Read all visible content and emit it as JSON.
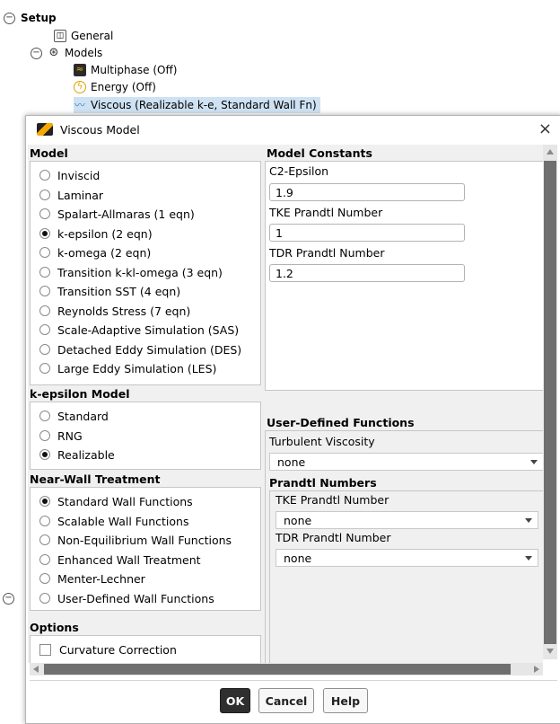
{
  "tree": {
    "setup": "Setup",
    "general": "General",
    "models": "Models",
    "multiphase": "Multiphase (Off)",
    "energy": "Energy (Off)",
    "viscous": "Viscous (Realizable k-e, Standard Wall Fn)"
  },
  "dialog": {
    "title": "Viscous Model",
    "close": "×",
    "model": {
      "label": "Model",
      "options": [
        "Inviscid",
        "Laminar",
        "Spalart-Allmaras (1 eqn)",
        "k-epsilon (2 eqn)",
        "k-omega (2 eqn)",
        "Transition k-kl-omega (3 eqn)",
        "Transition SST (4 eqn)",
        "Reynolds Stress (7 eqn)",
        "Scale-Adaptive Simulation (SAS)",
        "Detached Eddy Simulation (DES)",
        "Large Eddy Simulation (LES)"
      ],
      "selected": "k-epsilon (2 eqn)"
    },
    "kepsilon": {
      "label": "k-epsilon Model",
      "options": [
        "Standard",
        "RNG",
        "Realizable"
      ],
      "selected": "Realizable"
    },
    "nearwall": {
      "label": "Near-Wall Treatment",
      "options": [
        "Standard Wall Functions",
        "Scalable Wall Functions",
        "Non-Equilibrium Wall Functions",
        "Enhanced Wall Treatment",
        "Menter-Lechner",
        "User-Defined Wall Functions"
      ],
      "selected": "Standard Wall Functions"
    },
    "options": {
      "label": "Options",
      "curvature": "Curvature Correction"
    },
    "constants": {
      "label": "Model Constants",
      "c2eps_label": "C2-Epsilon",
      "c2eps_value": "1.9",
      "tke_label": "TKE Prandtl Number",
      "tke_value": "1",
      "tdr_label": "TDR Prandtl Number",
      "tdr_value": "1.2"
    },
    "udf": {
      "label": "User-Defined Functions",
      "turb_visc_label": "Turbulent Viscosity",
      "turb_visc_value": "none",
      "prandtl_label": "Prandtl Numbers",
      "tke_label": "TKE Prandtl Number",
      "tke_value": "none",
      "tdr_label": "TDR Prandtl Number",
      "tdr_value": "none"
    },
    "buttons": {
      "ok": "OK",
      "cancel": "Cancel",
      "help": "Help"
    }
  }
}
